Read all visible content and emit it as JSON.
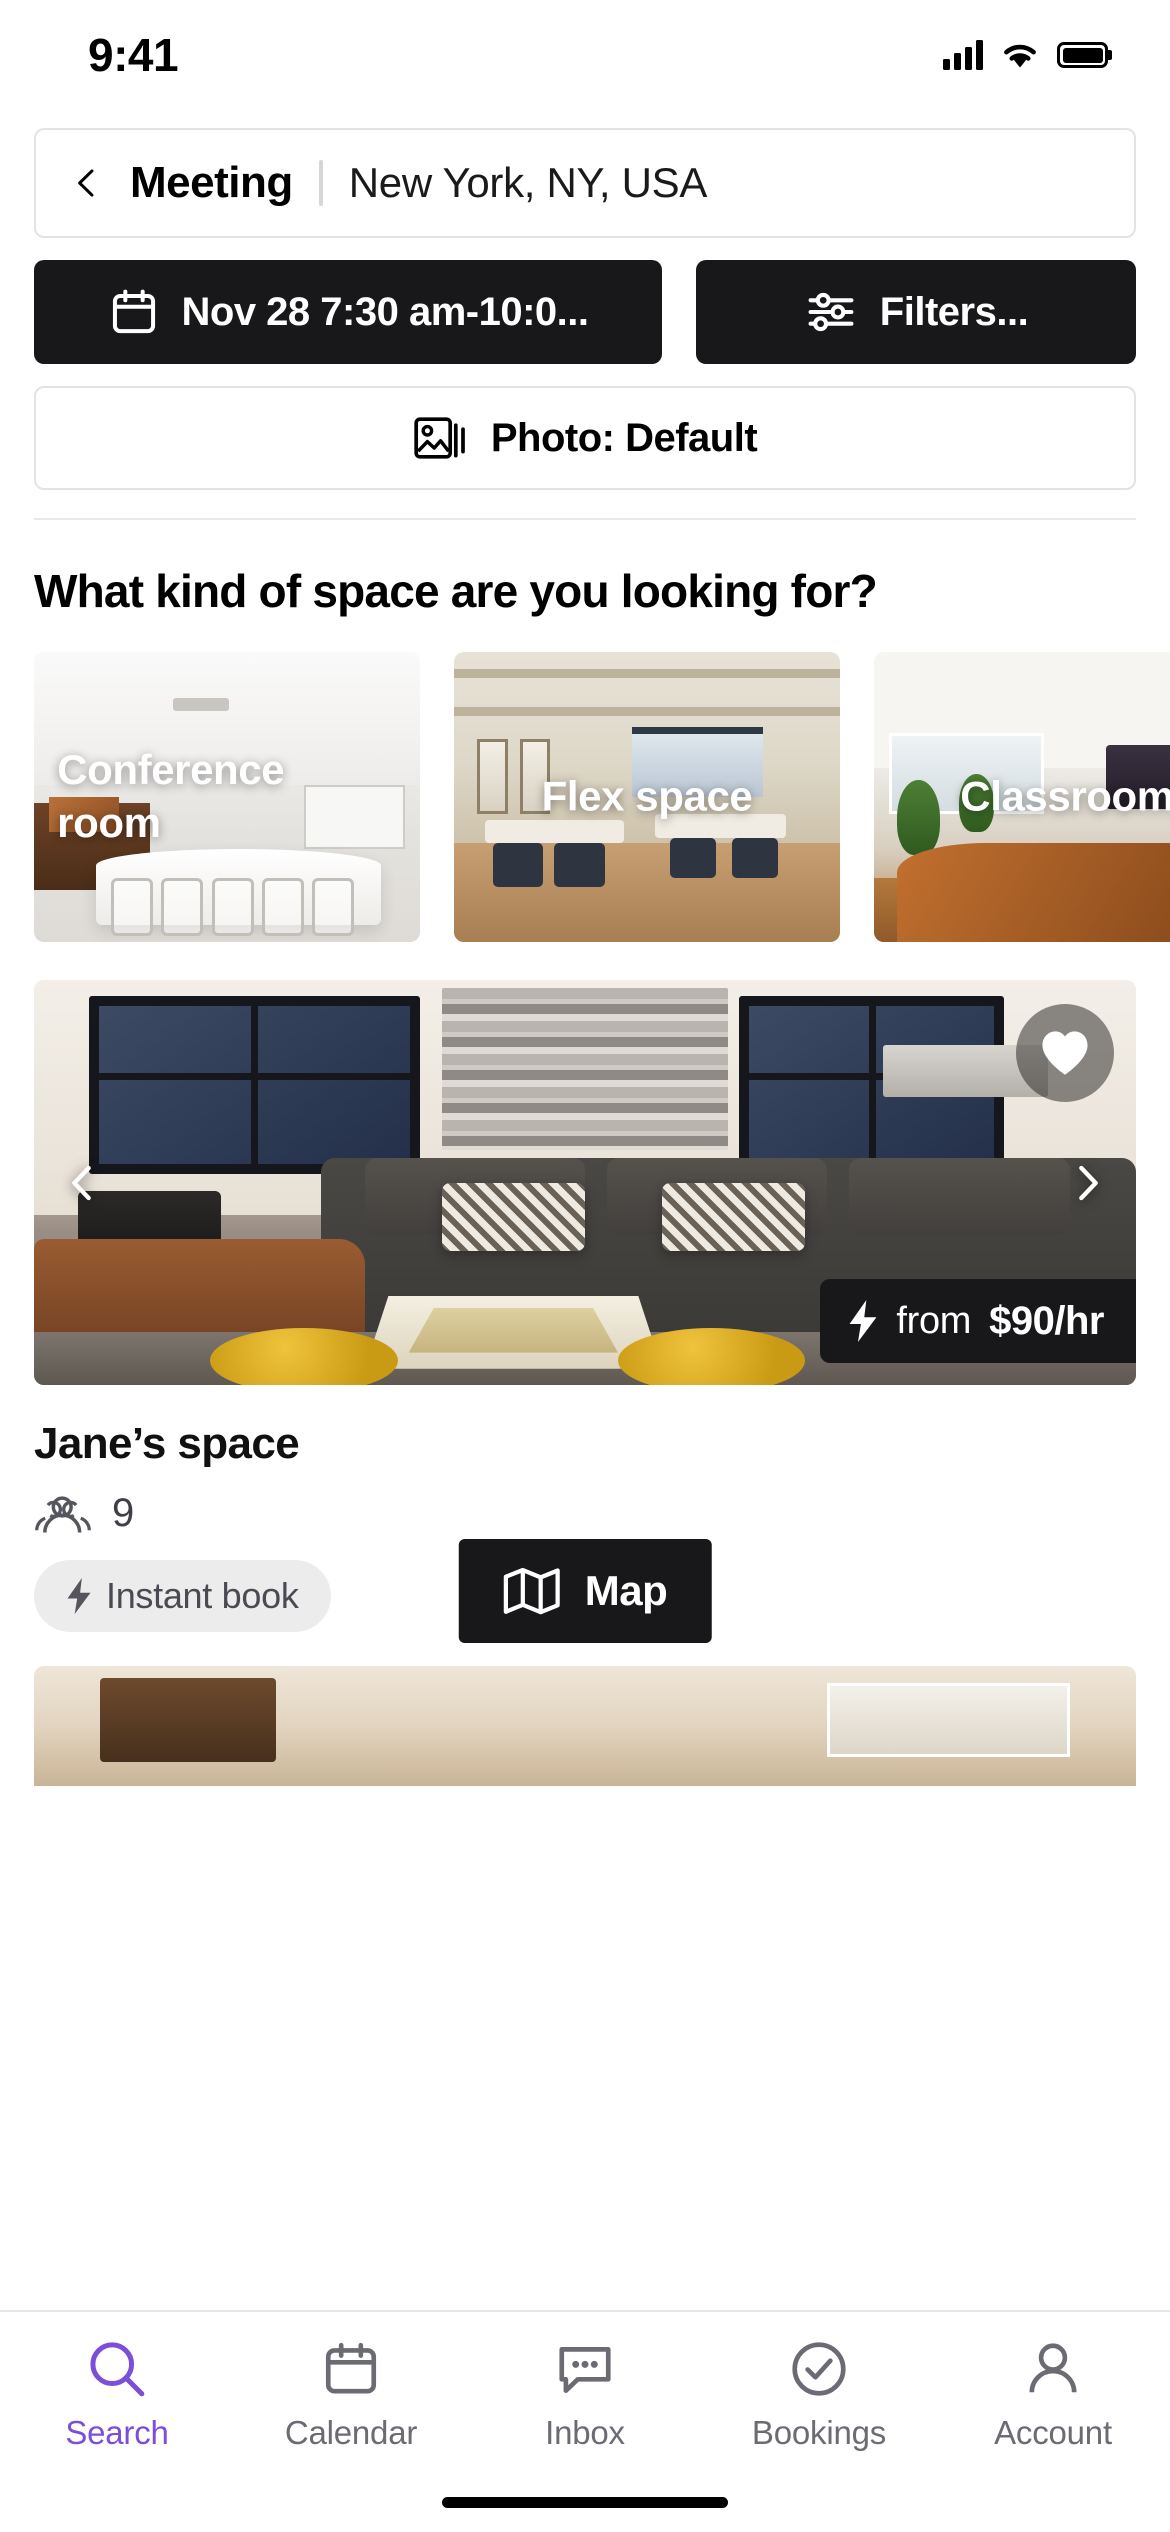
{
  "status_bar": {
    "time": "9:41",
    "cellular_icon": "cellular-signal-icon",
    "wifi_icon": "wifi-icon",
    "battery_icon": "battery-full-icon"
  },
  "header": {
    "back_icon": "chevron-left-icon",
    "search_type": "Meeting",
    "location": "New York, NY, USA",
    "date_filter": {
      "label": "Nov 28 7:30 am-10:0...",
      "icon": "calendar-icon"
    },
    "filters_button": {
      "label": "Filters...",
      "icon": "sliders-icon"
    },
    "photo_filter": {
      "label": "Photo: Default",
      "icon": "photo-stack-icon"
    }
  },
  "main": {
    "section_title": "What kind of space are you looking for?",
    "categories": [
      {
        "label": "Conference room"
      },
      {
        "label": "Flex space"
      },
      {
        "label": "Classroom"
      },
      {
        "label": ""
      }
    ],
    "listing": {
      "title": "Jane’s space",
      "capacity": "9",
      "capacity_icon": "people-icon",
      "instant_book": {
        "label": "Instant book",
        "icon": "lightning-bolt-icon"
      },
      "price": {
        "prefix": "from",
        "amount": "$90/hr",
        "icon": "lightning-bolt-icon"
      },
      "favorite_icon": "heart-filled-icon",
      "prev_icon": "chevron-left-icon",
      "next_icon": "chevron-right-icon"
    },
    "map_button": {
      "label": "Map",
      "icon": "map-icon"
    }
  },
  "tab_bar": {
    "active_color": "#7b4fd8",
    "inactive_color": "#6b6b73",
    "tabs": [
      {
        "label": "Search",
        "icon": "search-icon",
        "active": true
      },
      {
        "label": "Calendar",
        "icon": "calendar-icon",
        "active": false
      },
      {
        "label": "Inbox",
        "icon": "chat-icon",
        "active": false
      },
      {
        "label": "Bookings",
        "icon": "check-circle-icon",
        "active": false
      },
      {
        "label": "Account",
        "icon": "person-icon",
        "active": false
      }
    ]
  }
}
